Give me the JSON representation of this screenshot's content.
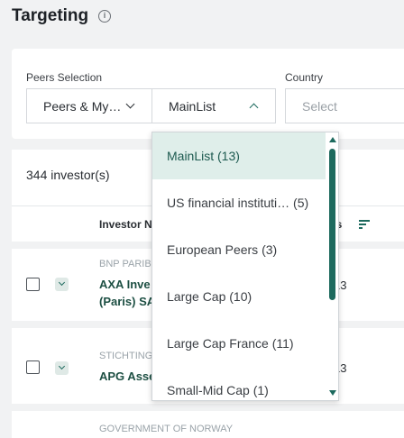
{
  "page": {
    "title": "Targeting"
  },
  "filters": {
    "peers_label": "Peers Selection",
    "peers_value": "Peers & My…",
    "list_value": "MainList",
    "country_label": "Country",
    "country_placeholder": "Select"
  },
  "list": {
    "count": "344 investor(s)",
    "col_investor": "Investor N",
    "col_other": "rs"
  },
  "rows": [
    {
      "parent": "BNP PARIB",
      "name_line1": "AXA Inve",
      "name_line2": "(Paris) SA",
      "value": "13"
    },
    {
      "parent": "STICHTING",
      "name_line1": "APG Asse",
      "name_line2": "",
      "value": "13"
    },
    {
      "parent": "GOVERNMENT OF NORWAY",
      "name_line1": "",
      "name_line2": "",
      "value": ""
    }
  ],
  "dropdown": {
    "options": [
      {
        "label": "MainList (13)",
        "selected": true
      },
      {
        "label": "US financial instituti… (5)",
        "selected": false
      },
      {
        "label": "European Peers (3)",
        "selected": false
      },
      {
        "label": "Large Cap (10)",
        "selected": false
      },
      {
        "label": "Large Cap France (11)",
        "selected": false
      },
      {
        "label": "Small-Mid Cap (1)",
        "selected": false
      }
    ]
  },
  "colors": {
    "accent": "#1d6a5e",
    "selected_bg": "#dfeeea",
    "background": "#f1f2f3"
  },
  "icons": [
    "info-icon",
    "chevron-down-icon",
    "chevron-up-icon",
    "sort-icon",
    "expand-chevron-icon"
  ]
}
